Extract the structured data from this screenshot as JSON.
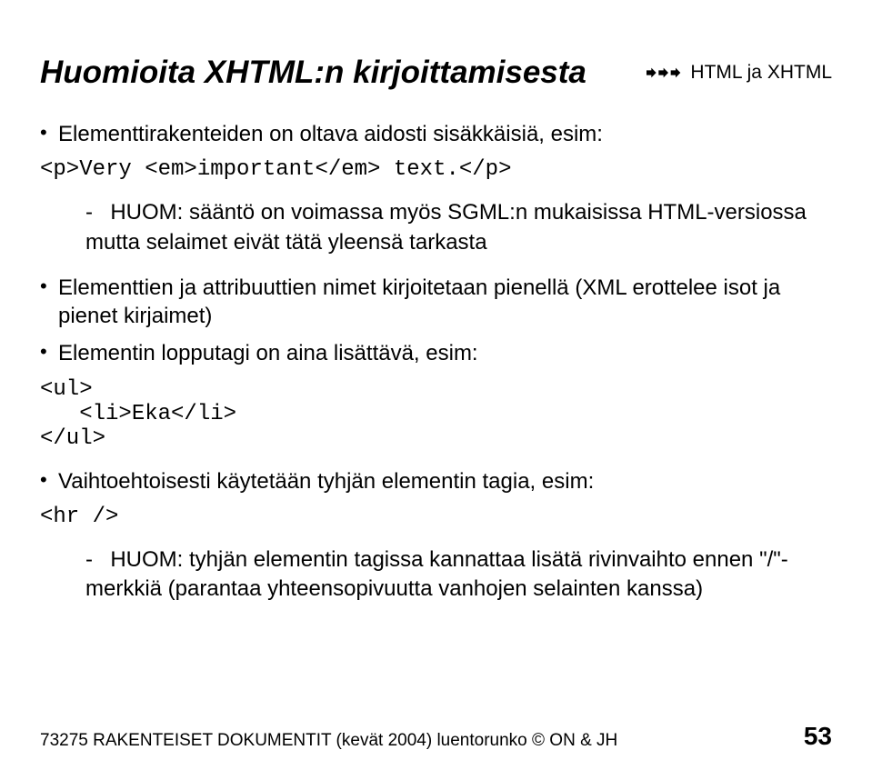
{
  "header": {
    "breadcrumb": "HTML ja XHTML"
  },
  "title": "Huomioita XHTML:n kirjoittamisesta",
  "bullets": {
    "b1": "Elementtirakenteiden on oltava aidosti sisäkkäisiä, esim:",
    "code1": "<p>Very <em>important</em> text.</p>",
    "note1": "HUOM: sääntö on voimassa myös SGML:n mukaisissa HTML-versiossa mutta selaimet eivät tätä yleensä tarkasta",
    "b2": "Elementtien ja attribuuttien nimet kirjoitetaan pienellä (XML erottelee isot ja pienet kirjaimet)",
    "b3": "Elementin lopputagi on aina lisättävä, esim:",
    "code2_line1": "<ul>",
    "code2_line2": "   <li>Eka</li>",
    "code2_line3": "</ul>",
    "b4": "Vaihtoehtoisesti käytetään tyhjän elementin tagia, esim:",
    "code3": "<hr />",
    "note2": "HUOM: tyhjän elementin tagissa kannattaa lisätä rivinvaihto ennen \"/\"-merkkiä (parantaa yhteensopivuutta vanhojen selainten kanssa)"
  },
  "footer": {
    "left": "73275 RAKENTEISET DOKUMENTIT (kevät 2004) luentorunko © ON & JH",
    "page": "53"
  }
}
